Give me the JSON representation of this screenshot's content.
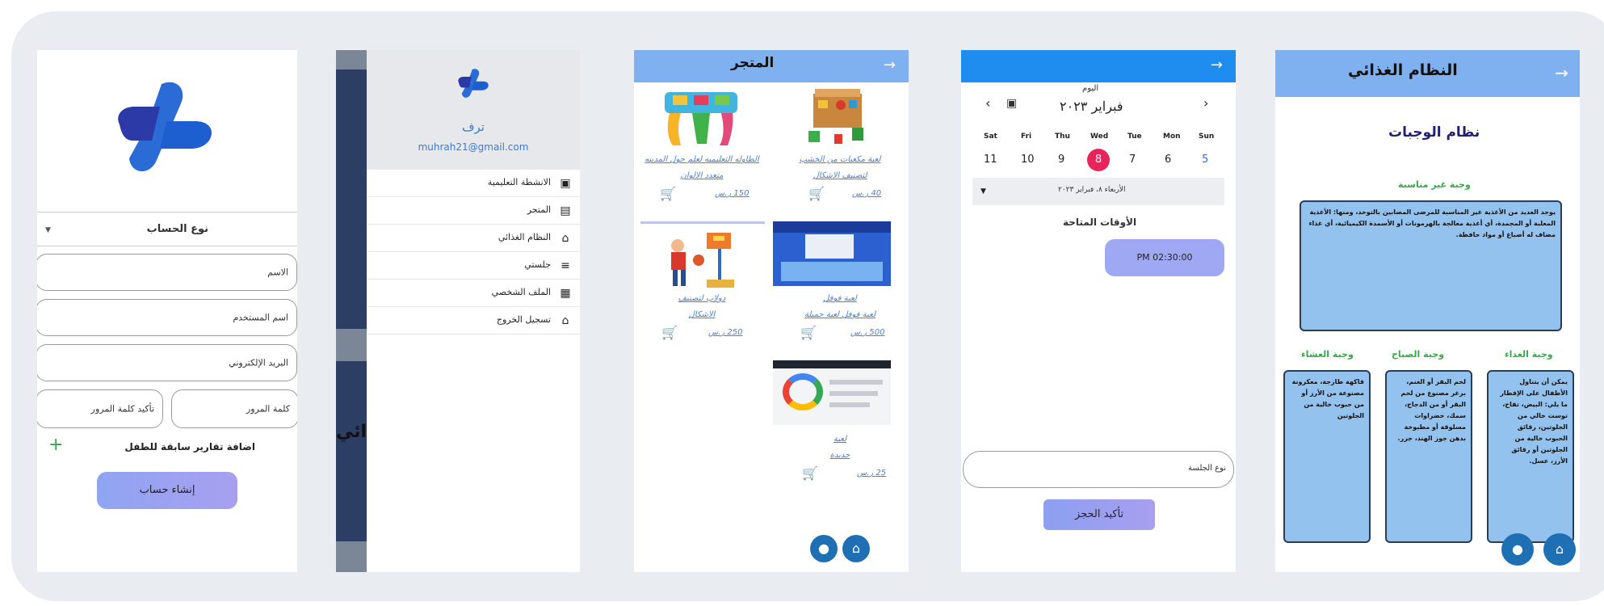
{
  "signup": {
    "account_type": "نوع الحساب",
    "name_placeholder": "الاسم",
    "username_placeholder": "اسم المستخدم",
    "email_placeholder": "البريد الإلكتروني",
    "password_placeholder": "كلمة المرور",
    "confirm_password_placeholder": "تأكيد كلمة المرور",
    "add_reports": "اضافة تقارير سابقة للطفل",
    "create_button": "إنشاء حساب",
    "add_icon": "plus-icon"
  },
  "drawer": {
    "app_name": "ترف",
    "email": "muhrah21@gmail.com",
    "items": [
      {
        "label": "الانشطة التعليمية",
        "icon": "activities-icon"
      },
      {
        "label": "المتجر",
        "icon": "store-icon"
      },
      {
        "label": "النظام الغذائي",
        "icon": "diet-icon"
      },
      {
        "label": "جلستي",
        "icon": "list-icon"
      },
      {
        "label": "الملف الشخصي",
        "icon": "profile-icon"
      },
      {
        "label": "تسجيل الخروج",
        "icon": "home-icon"
      }
    ],
    "behind_text": "ائي"
  },
  "store": {
    "title": "المتجر",
    "products": [
      {
        "name1": "لعبة مكعبات من الخشب",
        "name2": "لتصنيف الاشكال",
        "price": "40 ر.س"
      },
      {
        "name1": "الطاوله التعليميه لعلم حول المدينه",
        "name2": "متعدد الالوان",
        "price": "150 ر.س"
      },
      {
        "name1": "لعبة فوفل",
        "name2": "لعبة فوفل لعبة جميلة",
        "price": "500 ر.س"
      },
      {
        "name1": "دولاب لتصنيف",
        "name2": "الاشكال",
        "price": "250 ر.س"
      },
      {
        "name1": "لعبة",
        "name2": "جديدة",
        "price": "25 ر.س"
      }
    ]
  },
  "booking": {
    "today_label": "اليوم",
    "month": "فبراير ٢٠٢٣",
    "weekdays": [
      "Sat",
      "Fri",
      "Thu",
      "Wed",
      "Tue",
      "Mon",
      "Sun"
    ],
    "dates": [
      "11",
      "10",
      "9",
      "8",
      "7",
      "6",
      "5"
    ],
    "selected_date": "الأربعاء ٨، فبراير ٢٠٢٣",
    "available_times": "الأوقات المتاحة",
    "time_slot": "PM 02:30:00",
    "session_type_placeholder": "نوع الجلسة",
    "confirm_button": "تأكيد الحجز"
  },
  "diet": {
    "title": "النظام الغذائي",
    "subtitle": "نظام الوجبات",
    "unsuitable_title": "وجبة غير مناسبة",
    "unsuitable_text": "يوجد العديد من الأغذية غير المناسبة للمرضى المصابين بالتوحد، ومنها: الأغذية المعلبة أو المجمدة، أي أغذية معالجة بالهرمونات أو الأسمدة الكيميائية، أي غذاء مضاف له أصباغ أو مواد حافظة.",
    "lunch_title": "وجبة الغداء",
    "lunch_text": "يمكن أن يتناول الأطفال على الإفطار ما يلي: البيض، تفاح، توست خالي من الجلوتين، رقائق الحبوب خالية من الجلوتين أو رقائق الأرز، عسل.",
    "breakfast_title": "وجبة الصباح",
    "breakfast_text": "لحم البقر أو الغنم، برغر مصنوع من لحم البقر أو من الدجاج، سمك، خضراوات مسلوقة أو مطبوخة بدهن جوز الهند، جزر.",
    "dinner_title": "وجبة العشاء",
    "dinner_text": "فاكهة طازجة، معكرونة مصنوعة من الأرز أو من حبوب خالية من الجلوتين"
  }
}
